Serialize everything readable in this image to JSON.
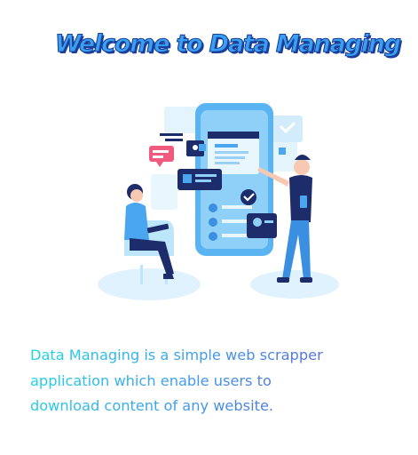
{
  "header": {
    "title": "Welcome to Data Managing"
  },
  "illustration": {
    "icon": "data-management-illustration"
  },
  "description": {
    "text": "Data Managing is a simple web scrapper application which enable users to download content of any website."
  },
  "colors": {
    "title_fill": "#3aa0f2",
    "title_outline": "#1b3f9a",
    "text_gradient_start": "#1fd6e4",
    "text_gradient_end": "#5b63d8",
    "illustration_primary": "#4aa6ee",
    "illustration_dark": "#1d2c6b"
  }
}
